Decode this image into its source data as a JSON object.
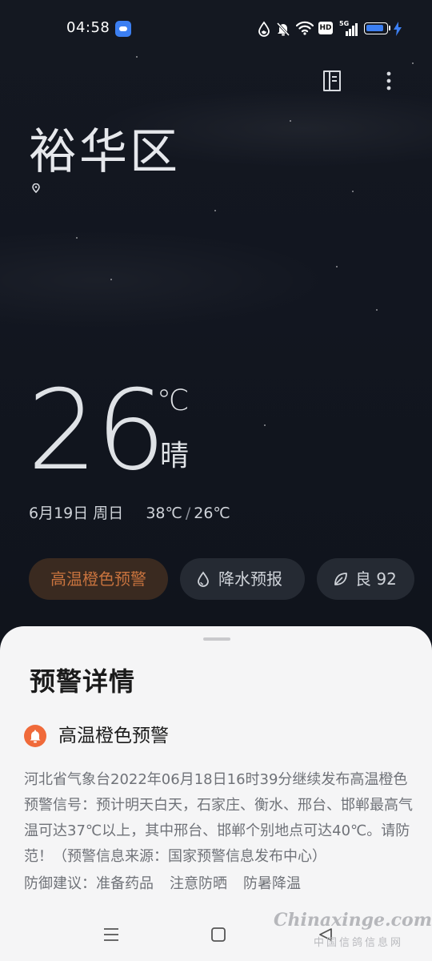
{
  "status_bar": {
    "time": "04:58",
    "hd_label": "HD",
    "network_label": "5G",
    "battery_percent": 90,
    "icons": [
      "app-notification-icon",
      "water-drop-icon",
      "bell-off-icon",
      "wifi-icon",
      "hd-icon",
      "5g-signal-icon",
      "battery-icon",
      "charging-bolt-icon"
    ]
  },
  "header": {
    "icons": [
      "city-manage-icon",
      "more-options-icon"
    ]
  },
  "location": {
    "city": "裕华区",
    "icon": "location-pin-icon"
  },
  "current": {
    "temperature": "26",
    "unit": "℃",
    "condition": "晴"
  },
  "forecast_line": {
    "date": "6月19日 周日",
    "high": "38℃",
    "separator": "/",
    "low": "26℃"
  },
  "chips": {
    "warning": "高温橙色预警",
    "rain": "降水预报",
    "rain_icon": "water-drop-outline-icon",
    "aqi": "良 92",
    "aqi_icon": "leaf-icon"
  },
  "sheet": {
    "title": "预警详情",
    "alert_icon": "bell-icon",
    "alert_title": "高温橙色预警",
    "alert_body": "河北省气象台2022年06月18日16时39分继续发布高温橙色预警信号：预计明天白天，石家庄、衡水、邢台、邯郸最高气温可达37℃以上，其中邢台、邯郸个别地点可达40℃。请防范！（预警信息来源：国家预警信息发布中心）",
    "advice_label": "防御建议：",
    "advice_items": [
      "准备药品",
      "注意防晒",
      "防暑降温"
    ]
  },
  "navbar": {
    "icons": [
      "menu-icon",
      "home-square-icon",
      "back-triangle-icon"
    ]
  },
  "watermark": {
    "text": "Chinaxinge.com",
    "sub": "中国信鸽信息网"
  },
  "colors": {
    "warning_accent": "#c8733e",
    "alert_icon_bg": "#f06a3a",
    "battery_fill": "#3c7ff2"
  }
}
